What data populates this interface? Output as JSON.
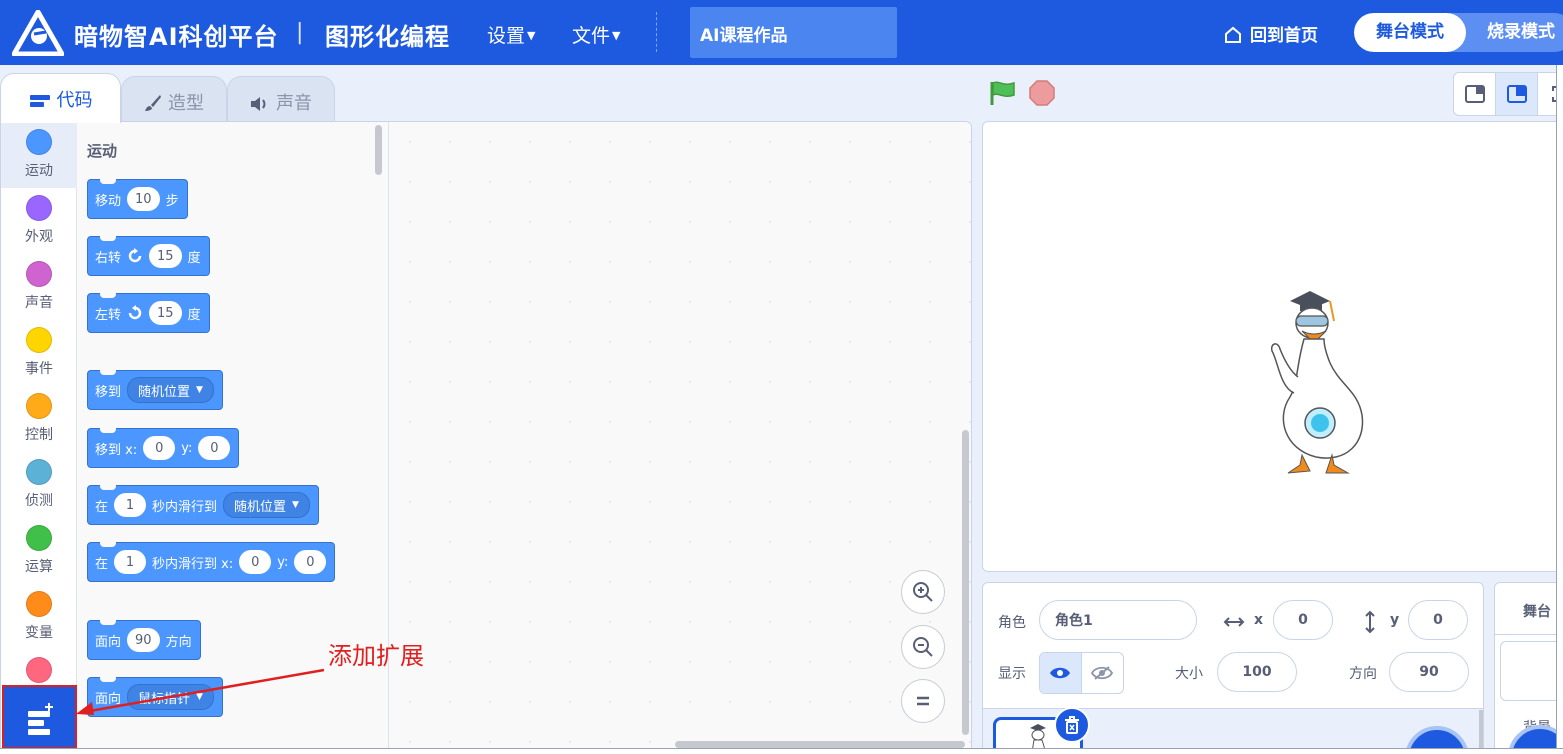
{
  "header": {
    "brand": "暗物智AI科创平台",
    "separator": "|",
    "subtitle": "图形化编程",
    "menus": [
      {
        "label": "设置"
      },
      {
        "label": "文件"
      }
    ],
    "project_title": "AI课程作品",
    "home_label": "回到首页",
    "mode_stage": "舞台模式",
    "mode_burn": "烧录模式",
    "accent_color": "#1e5ae0"
  },
  "tabs": [
    {
      "label": "代码",
      "icon": "code-blocks-icon",
      "active": true
    },
    {
      "label": "造型",
      "icon": "paintbrush-icon",
      "active": false
    },
    {
      "label": "声音",
      "icon": "speaker-icon",
      "active": false
    }
  ],
  "categories": [
    {
      "label": "运动",
      "color": "#4c97ff"
    },
    {
      "label": "外观",
      "color": "#9966ff"
    },
    {
      "label": "声音",
      "color": "#cf63cf"
    },
    {
      "label": "事件",
      "color": "#ffd500"
    },
    {
      "label": "控制",
      "color": "#ffab19"
    },
    {
      "label": "侦测",
      "color": "#5cb1d6"
    },
    {
      "label": "运算",
      "color": "#40bf4a"
    },
    {
      "label": "变量",
      "color": "#ff8c1a"
    },
    {
      "label": "",
      "color": "#ff6680"
    }
  ],
  "palette": {
    "section_title": "运动",
    "blocks": {
      "move": {
        "prefix": "移动",
        "value": "10",
        "suffix": "步"
      },
      "turn_right": {
        "prefix": "右转",
        "value": "15",
        "suffix": "度"
      },
      "turn_left": {
        "prefix": "左转",
        "value": "15",
        "suffix": "度"
      },
      "goto": {
        "prefix": "移到",
        "dropdown": "随机位置"
      },
      "goto_xy": {
        "prefix": "移到 x:",
        "x": "0",
        "ylabel": "y:",
        "y": "0"
      },
      "glide": {
        "prefix": "在",
        "secs": "1",
        "mid": "秒内滑行到",
        "dropdown": "随机位置"
      },
      "glide_xy": {
        "prefix": "在",
        "secs": "1",
        "mid": "秒内滑行到 x:",
        "x": "0",
        "ylabel": "y:",
        "y": "0"
      },
      "point_dir": {
        "prefix": "面向",
        "value": "90",
        "suffix": "方向"
      },
      "point_towards": {
        "prefix": "面向",
        "dropdown": "鼠标指针"
      }
    }
  },
  "annotation": {
    "text": "添加扩展"
  },
  "sprite_info": {
    "sprite_label": "角色",
    "sprite_name": "角色1",
    "x_label": "x",
    "x_value": "0",
    "y_label": "y",
    "y_value": "0",
    "show_label": "显示",
    "size_label": "大小",
    "size_value": "100",
    "direction_label": "方向",
    "direction_value": "90"
  },
  "stage_panel": {
    "title": "舞台",
    "backdrop_label": "背景"
  }
}
